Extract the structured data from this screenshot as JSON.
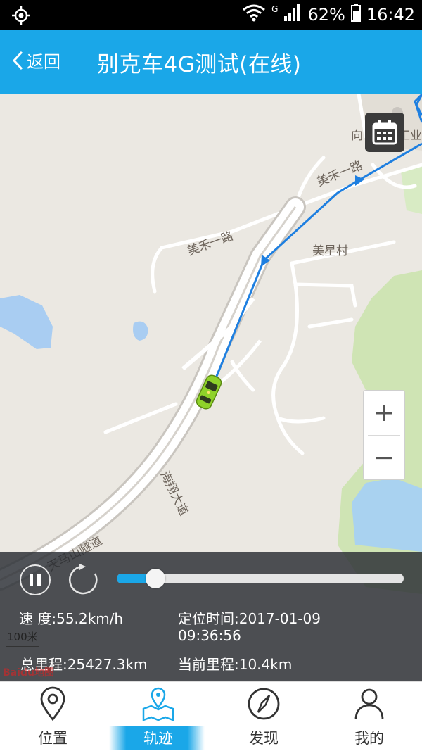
{
  "status_bar": {
    "network": "G",
    "battery": "62%",
    "time": "16:42"
  },
  "header": {
    "back_label": "返回",
    "title": "别克车4G测试(在线)"
  },
  "map": {
    "labels": [
      "向",
      "工业",
      "美禾一路",
      "美禾一路",
      "美星村",
      "海翔大道",
      "天马山隧道"
    ],
    "zoom_in": "+",
    "zoom_out": "−",
    "scale": "100米",
    "logo": "Baidu地图"
  },
  "playback": {
    "progress": 0.1,
    "speed_label": "速    度:55.2km/h",
    "time_label": "定位时间:2017-01-09",
    "time_value": "09:36:56",
    "total_mileage": "总里程:25427.3km",
    "current_mileage": "当前里程:10.4km"
  },
  "bottom_nav": [
    {
      "label": "位置",
      "icon": "location-pin-icon"
    },
    {
      "label": "轨迹",
      "icon": "track-map-icon",
      "active": true
    },
    {
      "label": "发现",
      "icon": "compass-icon"
    },
    {
      "label": "我的",
      "icon": "user-icon"
    }
  ],
  "colors": {
    "accent": "#1aa7e8",
    "track": "#1e7fe0",
    "car": "#8fd22a"
  }
}
